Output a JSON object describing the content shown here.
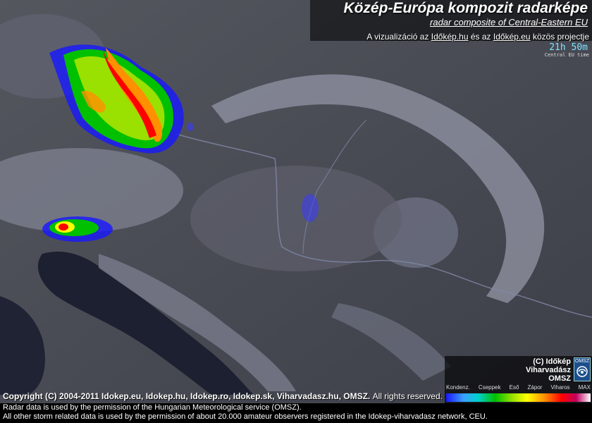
{
  "header": {
    "title": "Közép-Európa kompozit radarképe",
    "subtitle": "radar composite of Central-Eastern EU",
    "project_prefix": "A vizualizáció az",
    "project_link1": "Időkép.hu",
    "project_mid": "és az",
    "project_link2": "Időkép.eu",
    "project_suffix": "közös projectje"
  },
  "time": {
    "value": "21h 50m",
    "zone": "Central EU time"
  },
  "legend": {
    "brand_line1": "(C) Időkép",
    "brand_line2": "Viharvadász",
    "brand_line3": "OMSZ",
    "logo_text": "OMSZ",
    "labels": [
      "Kondenz.",
      "Cseppek",
      "Eső",
      "Zápor",
      "Viharos",
      "MAX"
    ]
  },
  "footer": {
    "copyright": "Copyright (C) 2004-2011  Idokep.eu, Idokep.hu, Idokep.ro, Idokep.sk, Viharvadasz.hu, OMSZ.",
    "rights": "All rights reserved.",
    "line2": "Radar data is used by the permission of the Hungarian Meteorological service (OMSZ).",
    "line3": "All other storm related data is used by the permission of about 20.000 amateur observers registered in the Idokep-viharvadasz network, CEU."
  },
  "colors": {
    "land": "#4a4c57",
    "mountain": "#6d6f7c",
    "sea": "#1c2030",
    "radar_low": "#1818ff",
    "radar_mid": "#00c000",
    "radar_high": "#ff0000"
  }
}
